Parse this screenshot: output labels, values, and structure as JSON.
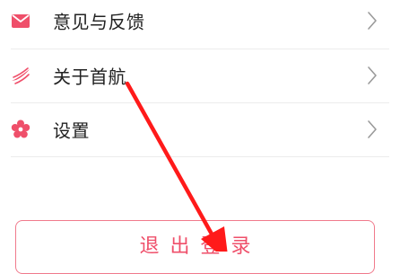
{
  "menu": {
    "items": [
      {
        "label": "意见与反馈",
        "icon": "feedback-envelope-icon"
      },
      {
        "label": "关于首航",
        "icon": "wings-logo-icon"
      },
      {
        "label": "设置",
        "icon": "settings-flower-icon"
      }
    ]
  },
  "logout": {
    "label": "退出登录"
  },
  "colors": {
    "accent": "#ef4f6a",
    "accent_border": "#f07a8c",
    "text": "#222222",
    "chevron": "#9a9a9a",
    "divider": "#ececec",
    "annotation_arrow": "#ff1a1a"
  }
}
